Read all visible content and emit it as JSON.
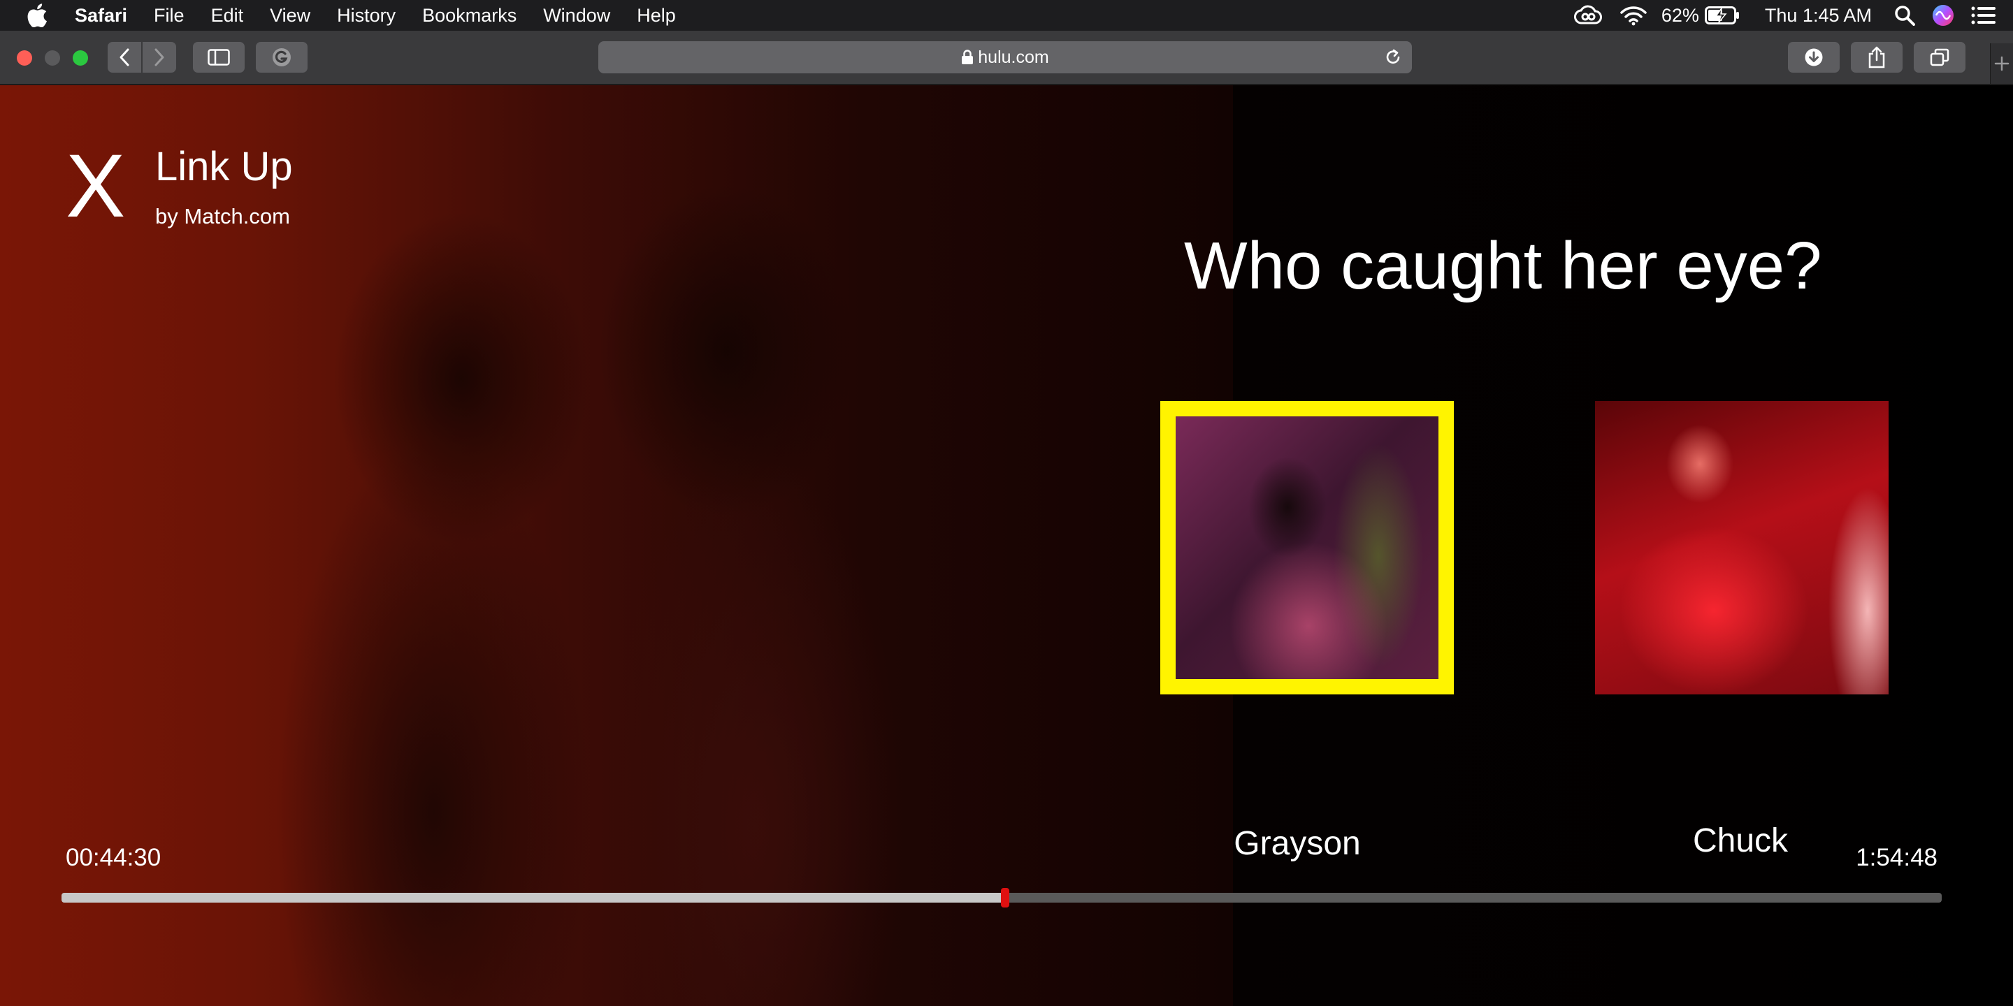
{
  "menubar": {
    "app_name": "Safari",
    "items": [
      "File",
      "Edit",
      "View",
      "History",
      "Bookmarks",
      "Window",
      "Help"
    ],
    "battery_percent": "62%",
    "clock": "Thu 1:45 AM"
  },
  "browser": {
    "url": "hulu.com"
  },
  "player": {
    "brand_mark": "X",
    "brand_title": "Link Up",
    "brand_subtitle": "by Match.com",
    "question": "Who caught her eye?",
    "choices": [
      {
        "name": "Grayson",
        "selected": true
      },
      {
        "name": "Chuck",
        "selected": false
      }
    ],
    "current_time": "00:44:30",
    "total_time": "1:54:48",
    "progress_fraction": 0.502,
    "highlight_color": "#fff400",
    "scrubber_color": "#e01010"
  }
}
